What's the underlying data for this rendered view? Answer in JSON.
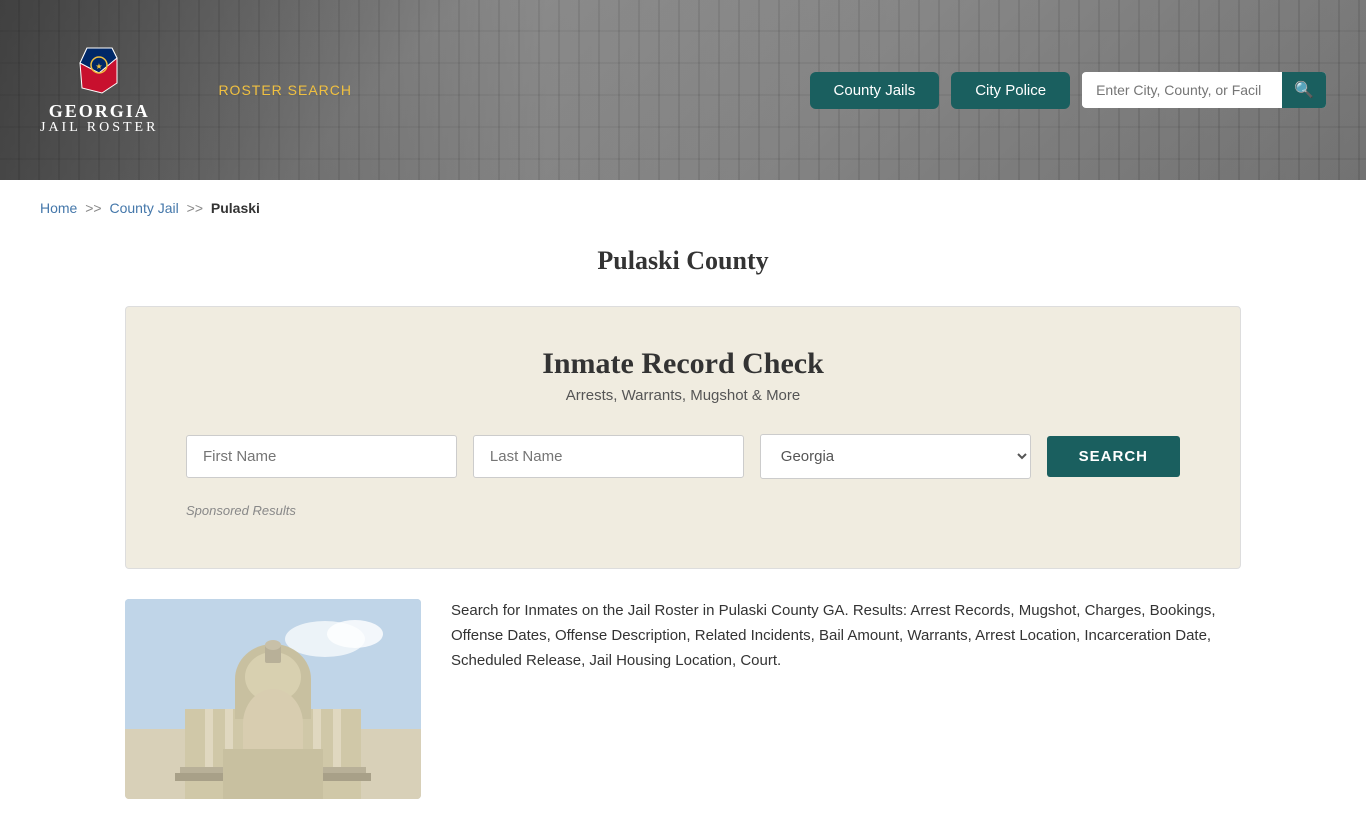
{
  "header": {
    "logo": {
      "line1": "GEORGIA",
      "line2": "JAIL ROSTER"
    },
    "nav_link_label": "ROSTER SEARCH",
    "nav_link_href": "#",
    "btn_county_jails": "County Jails",
    "btn_city_police": "City Police",
    "search_placeholder": "Enter City, County, or Facil"
  },
  "breadcrumb": {
    "home": "Home",
    "county_jail": "County Jail",
    "current": "Pulaski"
  },
  "page_title": "Pulaski County",
  "record_check": {
    "title": "Inmate Record Check",
    "subtitle": "Arrests, Warrants, Mugshot & More",
    "first_name_placeholder": "First Name",
    "last_name_placeholder": "Last Name",
    "state_default": "Georgia",
    "search_button": "SEARCH",
    "sponsored_label": "Sponsored Results"
  },
  "description": {
    "text": "Search for Inmates on the Jail Roster in Pulaski County GA. Results: Arrest Records, Mugshot, Charges, Bookings, Offense Dates, Offense Description, Related Incidents, Bail Amount, Warrants, Arrest Location, Incarceration Date, Scheduled Release, Jail Housing Location, Court."
  }
}
